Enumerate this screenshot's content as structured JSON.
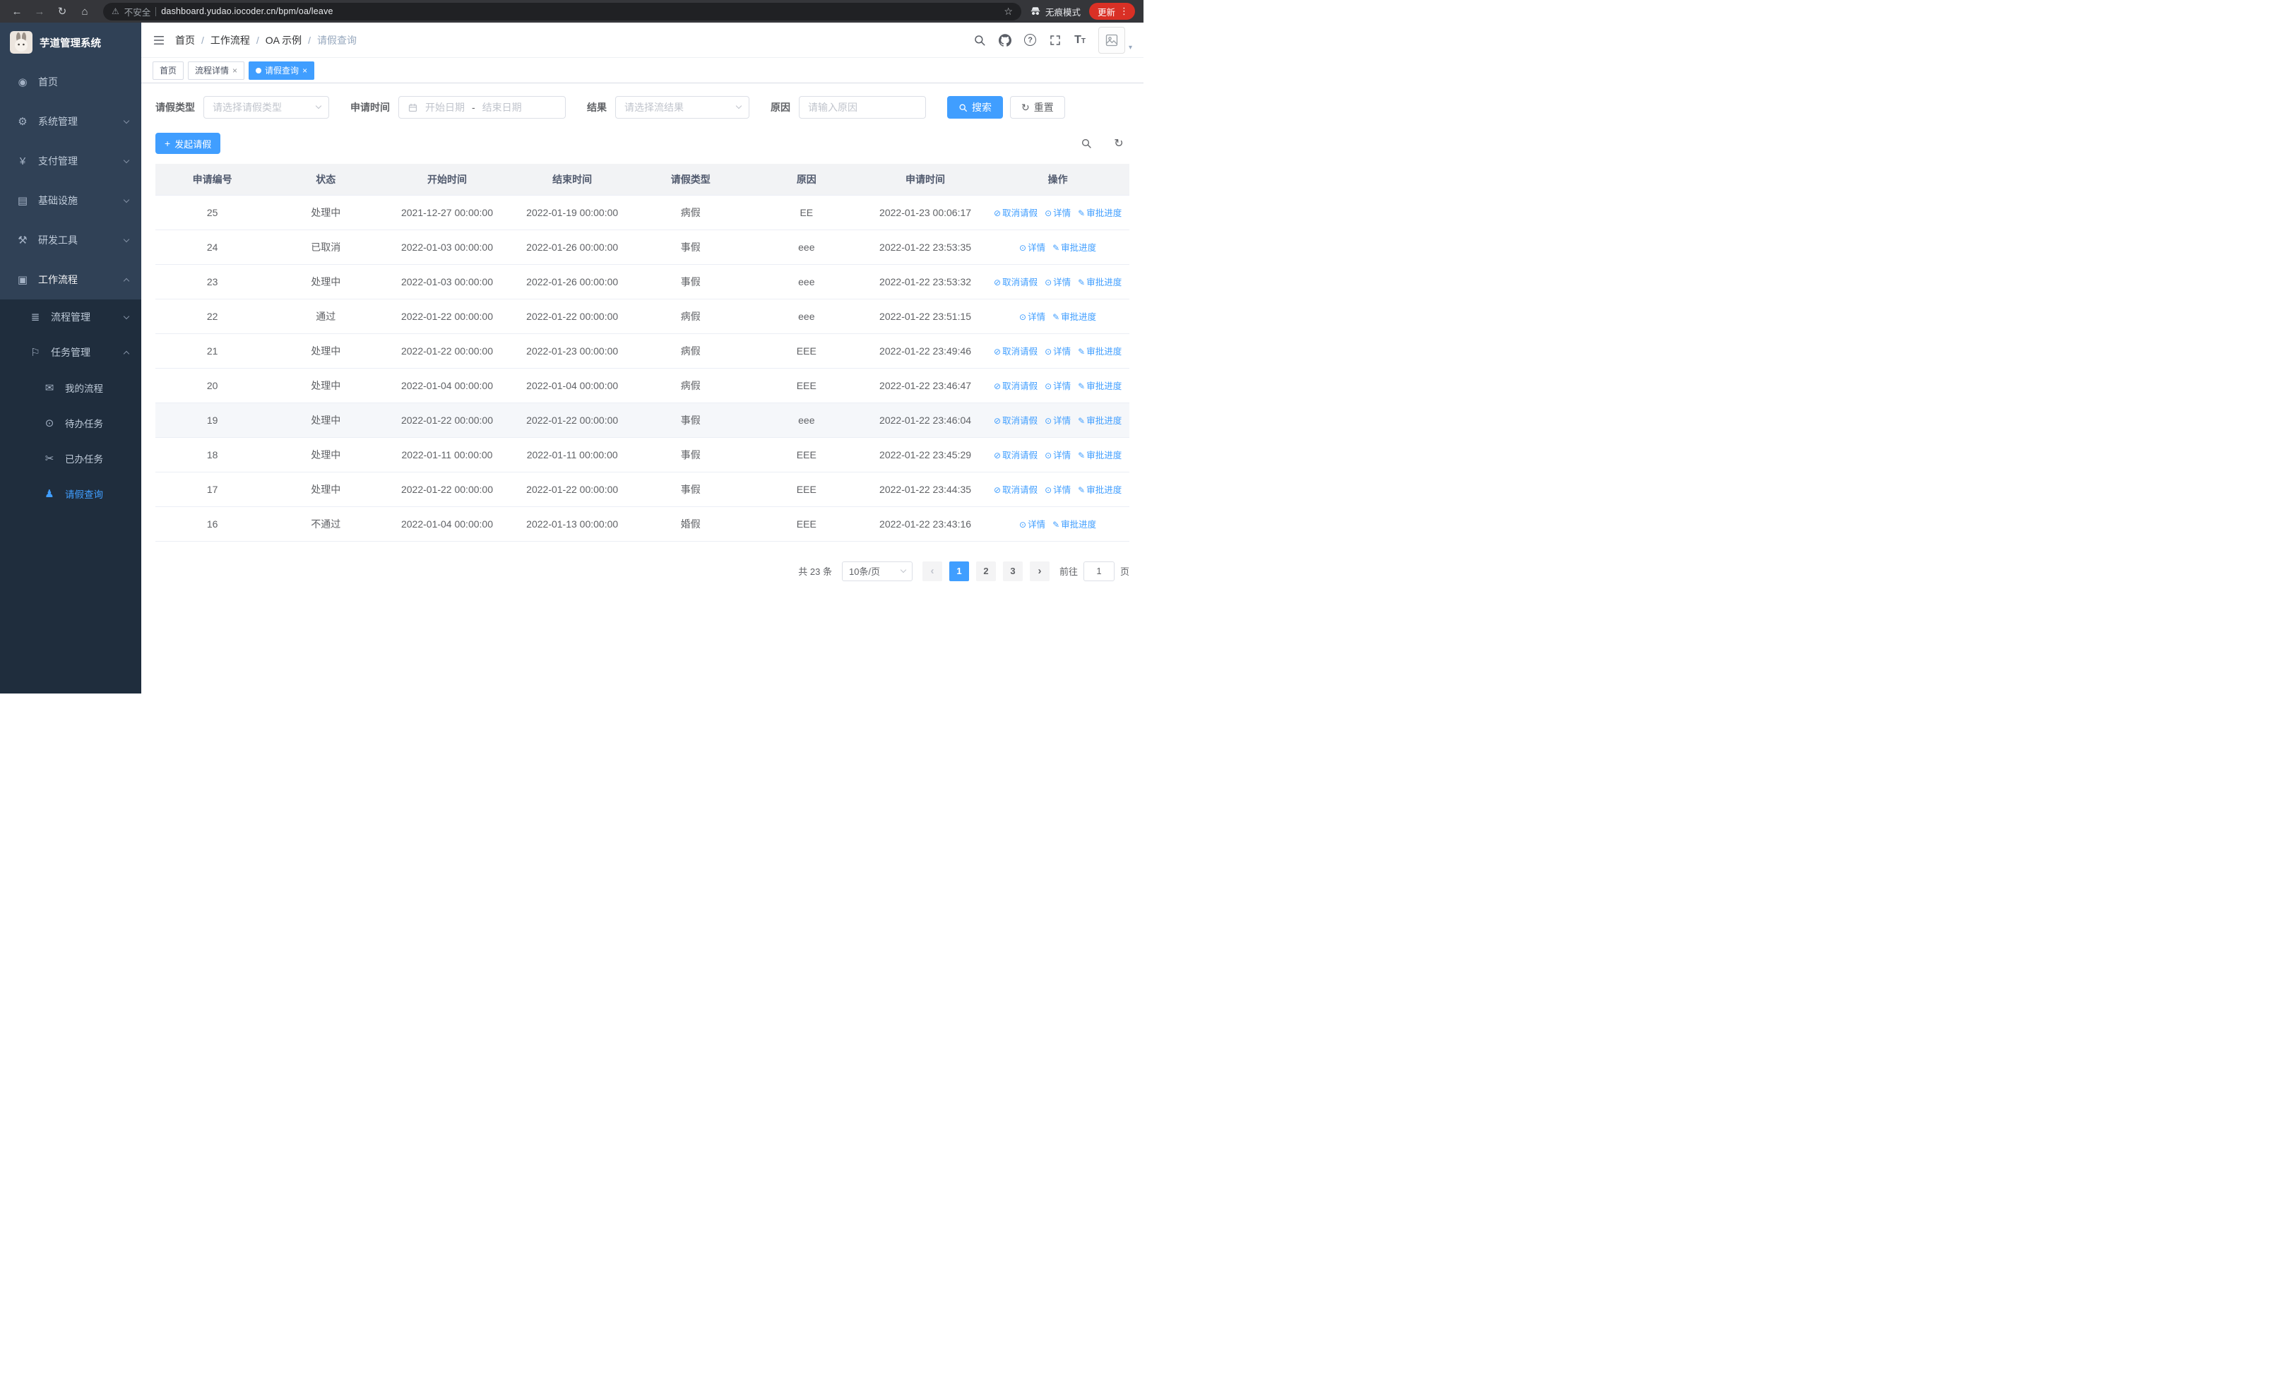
{
  "browser": {
    "security_warning": "不安全",
    "url": "dashboard.yudao.iocoder.cn/bpm/oa/leave",
    "incognito_label": "无痕模式",
    "update_label": "更新"
  },
  "colors": {
    "accent": "#409eff",
    "sidebar_bg": "#304156",
    "submenu_bg": "#1f2d3d",
    "update_pill": "#d93025",
    "table_header_bg": "#f2f3f5"
  },
  "icons": {
    "dashboard": "◉",
    "gear": "⚙",
    "yen": "¥",
    "infra": "▤",
    "tools": "⚒",
    "workflow": "▣",
    "process": "≣",
    "task": "⚐",
    "chat": "✉",
    "eye": "⊙",
    "scissors": "✂",
    "user": "♟",
    "plus": "+",
    "refresh": "↻",
    "back": "←",
    "forward": "→",
    "home": "⌂",
    "star": "☆",
    "warning": "⚠",
    "dots": "⋮",
    "caret_down": "▾",
    "question": "?"
  },
  "sidebar": {
    "logo_title": "芋道管理系统",
    "items": [
      {
        "label": "首页"
      },
      {
        "label": "系统管理"
      },
      {
        "label": "支付管理"
      },
      {
        "label": "基础设施"
      },
      {
        "label": "研发工具"
      },
      {
        "label": "工作流程"
      }
    ],
    "submenu": [
      {
        "label": "流程管理"
      },
      {
        "label": "任务管理"
      }
    ],
    "task_children": [
      {
        "label": "我的流程"
      },
      {
        "label": "待办任务"
      },
      {
        "label": "已办任务"
      },
      {
        "label": "请假查询"
      }
    ]
  },
  "header": {
    "breadcrumb": [
      "首页",
      "工作流程",
      "OA 示例",
      "请假查询"
    ]
  },
  "tabs": [
    {
      "label": "首页"
    },
    {
      "label": "流程详情"
    },
    {
      "label": "请假查询"
    }
  ],
  "filters": {
    "leave_type_label": "请假类型",
    "leave_type_placeholder": "请选择请假类型",
    "apply_time_label": "申请时间",
    "date_start_placeholder": "开始日期",
    "date_separator": "-",
    "date_end_placeholder": "结束日期",
    "result_label": "结果",
    "result_placeholder": "请选择流结果",
    "reason_label": "原因",
    "reason_placeholder": "请输入原因",
    "search_button": "搜索",
    "reset_button": "重置"
  },
  "toolbar": {
    "create_button": "发起请假"
  },
  "table": {
    "columns": [
      "申请编号",
      "状态",
      "开始时间",
      "结束时间",
      "请假类型",
      "原因",
      "申请时间",
      "操作"
    ],
    "action_defs": {
      "cancel": {
        "label": "取消请假",
        "icon": "cancel-icon",
        "glyph": "⊘"
      },
      "detail": {
        "label": "详情",
        "icon": "eye-icon",
        "glyph": "⊙"
      },
      "progress": {
        "label": "审批进度",
        "icon": "edit-icon",
        "glyph": "✎"
      }
    },
    "rows": [
      {
        "id": "25",
        "status": "处理中",
        "start": "2021-12-27 00:00:00",
        "end": "2022-01-19 00:00:00",
        "type": "病假",
        "reason": "EE",
        "applied": "2022-01-23 00:06:17",
        "actions": [
          "cancel",
          "detail",
          "progress"
        ]
      },
      {
        "id": "24",
        "status": "已取消",
        "start": "2022-01-03 00:00:00",
        "end": "2022-01-26 00:00:00",
        "type": "事假",
        "reason": "eee",
        "applied": "2022-01-22 23:53:35",
        "actions": [
          "detail",
          "progress"
        ]
      },
      {
        "id": "23",
        "status": "处理中",
        "start": "2022-01-03 00:00:00",
        "end": "2022-01-26 00:00:00",
        "type": "事假",
        "reason": "eee",
        "applied": "2022-01-22 23:53:32",
        "actions": [
          "cancel",
          "detail",
          "progress"
        ]
      },
      {
        "id": "22",
        "status": "通过",
        "start": "2022-01-22 00:00:00",
        "end": "2022-01-22 00:00:00",
        "type": "病假",
        "reason": "eee",
        "applied": "2022-01-22 23:51:15",
        "actions": [
          "detail",
          "progress"
        ]
      },
      {
        "id": "21",
        "status": "处理中",
        "start": "2022-01-22 00:00:00",
        "end": "2022-01-23 00:00:00",
        "type": "病假",
        "reason": "EEE",
        "applied": "2022-01-22 23:49:46",
        "actions": [
          "cancel",
          "detail",
          "progress"
        ]
      },
      {
        "id": "20",
        "status": "处理中",
        "start": "2022-01-04 00:00:00",
        "end": "2022-01-04 00:00:00",
        "type": "病假",
        "reason": "EEE",
        "applied": "2022-01-22 23:46:47",
        "actions": [
          "cancel",
          "detail",
          "progress"
        ]
      },
      {
        "id": "19",
        "status": "处理中",
        "start": "2022-01-22 00:00:00",
        "end": "2022-01-22 00:00:00",
        "type": "事假",
        "reason": "eee",
        "applied": "2022-01-22 23:46:04",
        "actions": [
          "cancel",
          "detail",
          "progress"
        ],
        "hover": true
      },
      {
        "id": "18",
        "status": "处理中",
        "start": "2022-01-11 00:00:00",
        "end": "2022-01-11 00:00:00",
        "type": "事假",
        "reason": "EEE",
        "applied": "2022-01-22 23:45:29",
        "actions": [
          "cancel",
          "detail",
          "progress"
        ]
      },
      {
        "id": "17",
        "status": "处理中",
        "start": "2022-01-22 00:00:00",
        "end": "2022-01-22 00:00:00",
        "type": "事假",
        "reason": "EEE",
        "applied": "2022-01-22 23:44:35",
        "actions": [
          "cancel",
          "detail",
          "progress"
        ]
      },
      {
        "id": "16",
        "status": "不通过",
        "start": "2022-01-04 00:00:00",
        "end": "2022-01-13 00:00:00",
        "type": "婚假",
        "reason": "EEE",
        "applied": "2022-01-22 23:43:16",
        "actions": [
          "detail",
          "progress"
        ]
      }
    ]
  },
  "pagination": {
    "total_text": "共 23 条",
    "page_size": "10条/页",
    "pages": [
      "1",
      "2",
      "3"
    ],
    "active_page": "1",
    "goto_label": "前往",
    "goto_value": "1",
    "goto_suffix": "页"
  }
}
